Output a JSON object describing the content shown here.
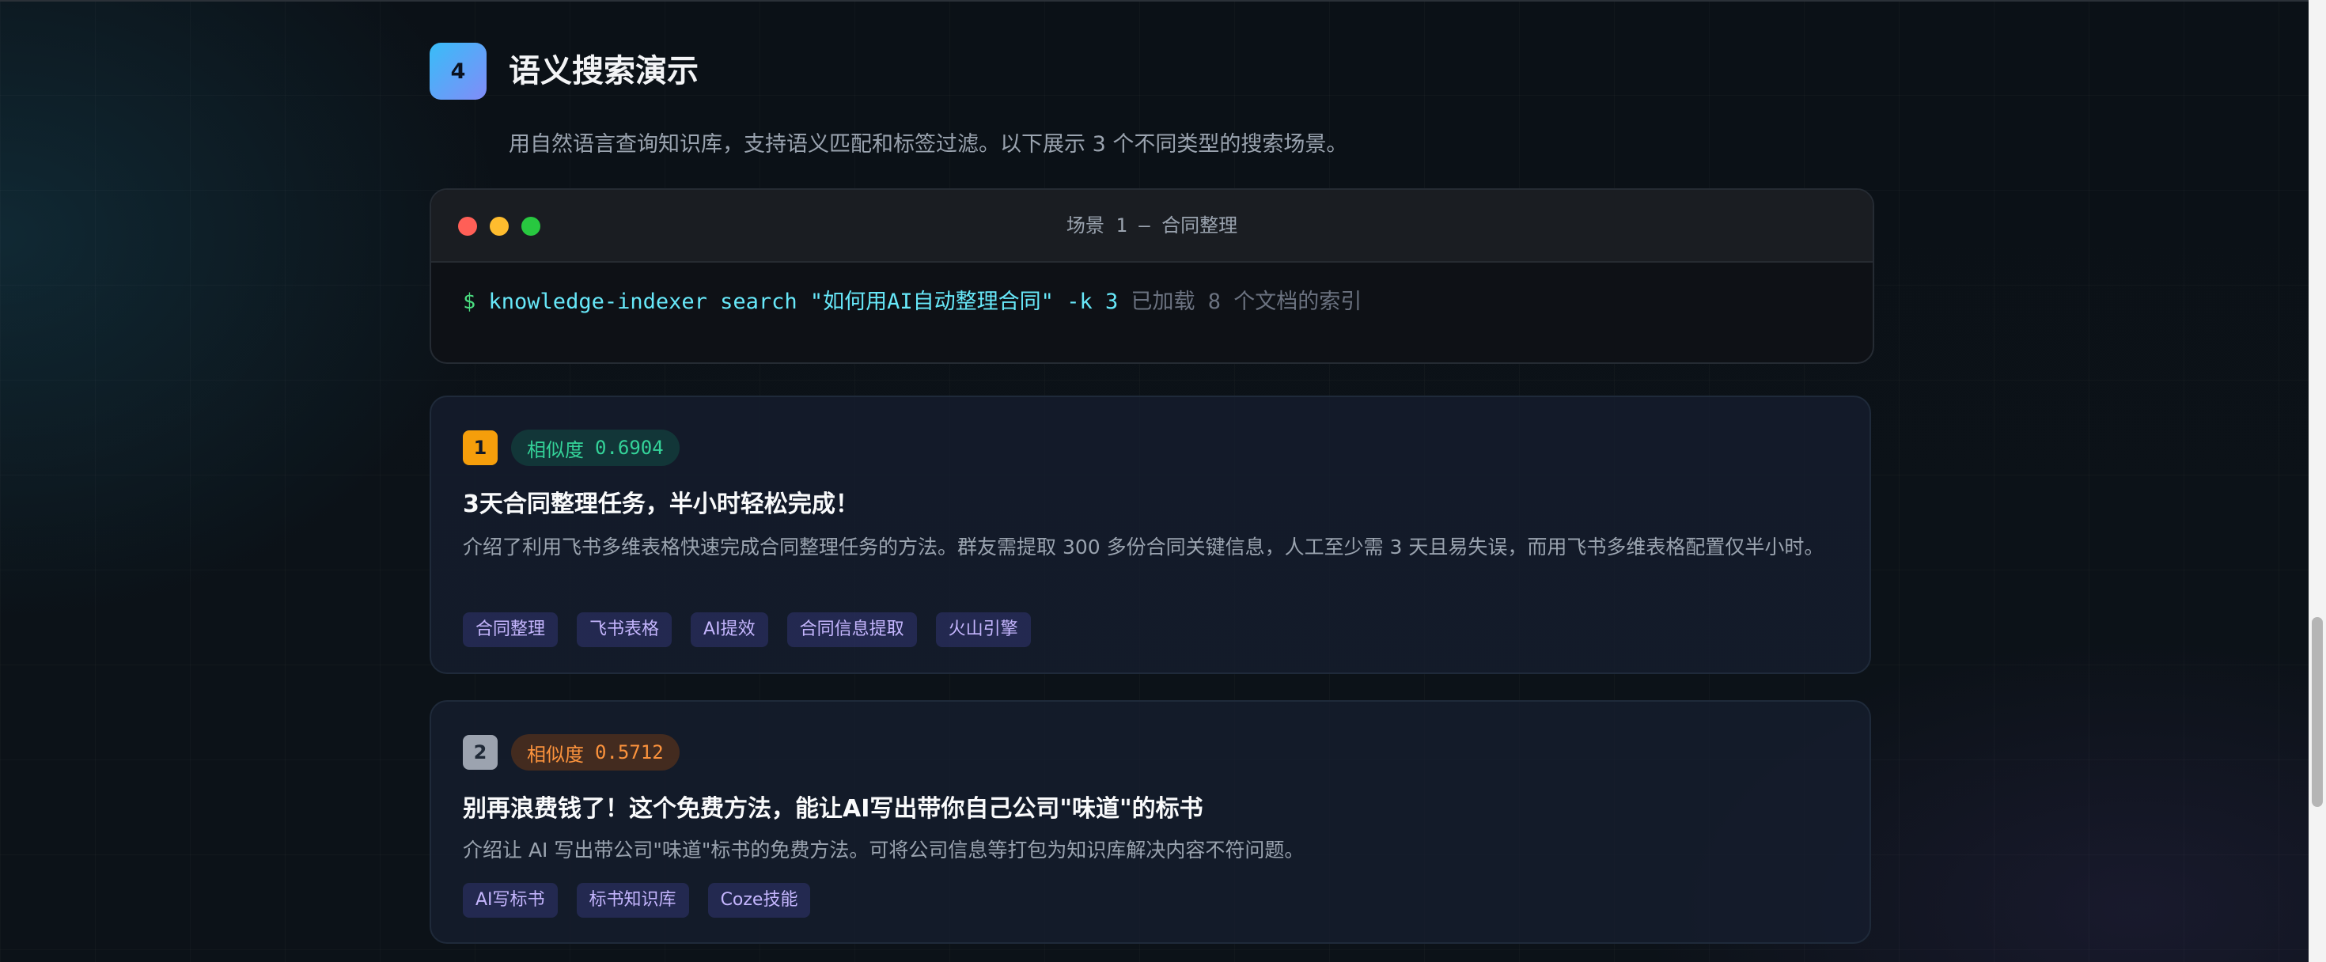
{
  "section": {
    "number": "4",
    "title": "语义搜索演示",
    "description": "用自然语言查询知识库，支持语义匹配和标签过滤。以下展示 3 个不同类型的搜索场景。"
  },
  "terminal": {
    "title": "场景 1 — 合同整理",
    "prompt": "$",
    "command": "knowledge-indexer search \"如何用AI自动整理合同\" -k 3",
    "output": "已加载 8 个文档的索引"
  },
  "results": [
    {
      "rank": "1",
      "score_label": "相似度",
      "score": "0.6904",
      "title": "3天合同整理任务，半小时轻松完成！",
      "description": "介绍了利用飞书多维表格快速完成合同整理任务的方法。群友需提取 300 多份合同关键信息，人工至少需 3 天且易失误，而用飞书多维表格配置仅半小时。",
      "tags": [
        "合同整理",
        "飞书表格",
        "AI提效",
        "合同信息提取",
        "火山引擎"
      ]
    },
    {
      "rank": "2",
      "score_label": "相似度",
      "score": "0.5712",
      "title": "别再浪费钱了！这个免费方法，能让AI写出带你自己公司\"味道\"的标书",
      "description": "介绍让 AI 写出带公司\"味道\"标书的免费方法。可将公司信息等打包为知识库解决内容不符问题。",
      "tags": [
        "AI写标书",
        "标书知识库",
        "Coze技能"
      ]
    }
  ]
}
